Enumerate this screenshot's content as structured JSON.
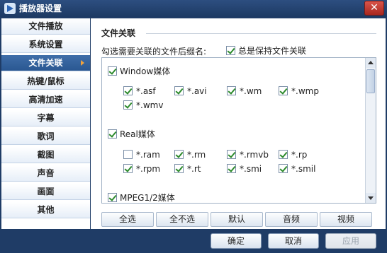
{
  "window": {
    "title": "播放器设置",
    "app_icon": "player-app-icon",
    "close_label": "✕"
  },
  "sidebar": {
    "items": [
      {
        "label": "文件播放",
        "active": false
      },
      {
        "label": "系统设置",
        "active": false
      },
      {
        "label": "文件关联",
        "active": true
      },
      {
        "label": "热键/鼠标",
        "active": false
      },
      {
        "label": "高清加速",
        "active": false
      },
      {
        "label": "字幕",
        "active": false
      },
      {
        "label": "歌词",
        "active": false
      },
      {
        "label": "截图",
        "active": false
      },
      {
        "label": "声音",
        "active": false
      },
      {
        "label": "画面",
        "active": false
      },
      {
        "label": "其他",
        "active": false
      }
    ]
  },
  "main": {
    "section_title": "文件关联",
    "hint": "勾选需要关联的文件后缀名:",
    "keep_assoc": {
      "label": "总是保持文件关联",
      "checked": true
    },
    "groups": [
      {
        "label": "Window媒体",
        "checked": true,
        "extensions": [
          {
            "label": "*.asf",
            "checked": true
          },
          {
            "label": "*.avi",
            "checked": true
          },
          {
            "label": "*.wm",
            "checked": true
          },
          {
            "label": "*.wmp",
            "checked": true
          },
          {
            "label": "*.wmv",
            "checked": true
          }
        ]
      },
      {
        "label": "Real媒体",
        "checked": true,
        "extensions": [
          {
            "label": "*.ram",
            "checked": false
          },
          {
            "label": "*.rm",
            "checked": true
          },
          {
            "label": "*.rmvb",
            "checked": true
          },
          {
            "label": "*.rp",
            "checked": true
          },
          {
            "label": "*.rpm",
            "checked": true
          },
          {
            "label": "*.rt",
            "checked": true
          },
          {
            "label": "*.smi",
            "checked": true
          },
          {
            "label": "*.smil",
            "checked": true
          }
        ]
      },
      {
        "label": "MPEG1/2媒体",
        "checked": true,
        "extensions": []
      }
    ],
    "quick_buttons": [
      "全选",
      "全不选",
      "默认",
      "音频",
      "视频"
    ]
  },
  "footer": {
    "ok_label": "确定",
    "cancel_label": "取消",
    "apply_label": "应用",
    "apply_disabled": true
  },
  "colors": {
    "frame": "#1f3c66",
    "nav_active": "#2f5f9c",
    "check_mark": "#2c8a2c",
    "close_button": "#c23b32"
  }
}
